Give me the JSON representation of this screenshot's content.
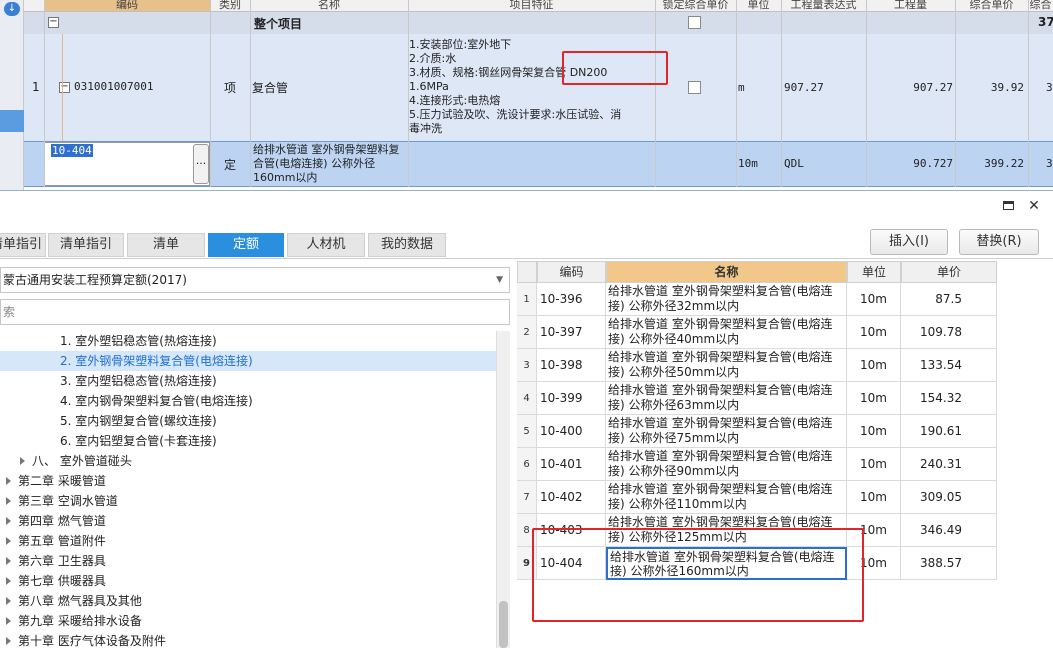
{
  "grid": {
    "headers": {
      "code": "编码",
      "type": "类别",
      "name": "名称",
      "feature": "项目特征",
      "lock": "锁定综合单价",
      "unit": "单位",
      "expr": "工程量表达式",
      "qty": "工程量",
      "price": "综合单价",
      "total": "综合"
    },
    "group_row": {
      "label": "整个项目",
      "total": "37"
    },
    "item_row": {
      "index": "1",
      "code": "031001007001",
      "type": "项",
      "name": "复合管",
      "features": [
        "1.安装部位:室外地下",
        "2.介质:水",
        "3.材质、规格:钢丝网骨架复合管 DN200",
        "1.6MPa",
        "4.连接形式:电热熔",
        "5.压力试验及吹、洗设计要求:水压试验、消",
        "毒冲洗"
      ],
      "unit": "m",
      "expr": "907.27",
      "qty": "907.27",
      "price": "39.92",
      "total": "3"
    },
    "quota_row": {
      "code": "10-404",
      "more": "···",
      "type": "定",
      "name": "给排水管道 室外钢骨架塑料复合管(电熔连接) 公称外径160mm以内",
      "unit": "10m",
      "expr": "QDL",
      "qty": "90.727",
      "price": "399.22",
      "total": "3"
    }
  },
  "dialog": {
    "tabs": [
      "清单指引",
      "清单指引",
      "清单",
      "定额",
      "人材机",
      "我的数据"
    ],
    "active_tab": 3,
    "insert_button": "插入(I)",
    "replace_button": "替换(R)",
    "library": "蒙古通用安装工程预算定额(2017)",
    "search_placeholder": "索",
    "tree": [
      {
        "label": "1. 室外塑铝稳态管(热熔连接)",
        "level": 3
      },
      {
        "label": "2. 室外钢骨架塑料复合管(电熔连接)",
        "level": 3,
        "selected": true
      },
      {
        "label": "3. 室内塑铝稳态管(热熔连接)",
        "level": 3
      },
      {
        "label": "4. 室内钢骨架塑料复合管(电熔连接)",
        "level": 3
      },
      {
        "label": "5. 室内钢塑复合管(螺纹连接)",
        "level": 3
      },
      {
        "label": "6. 室内铝塑复合管(卡套连接)",
        "level": 3
      },
      {
        "label": "八、 室外管道碰头",
        "level": 2
      },
      {
        "label": "第二章 采暖管道",
        "level": 1
      },
      {
        "label": "第三章 空调水管道",
        "level": 1
      },
      {
        "label": "第四章 燃气管道",
        "level": 1
      },
      {
        "label": "第五章 管道附件",
        "level": 1
      },
      {
        "label": "第六章 卫生器具",
        "level": 1
      },
      {
        "label": "第七章 供暖器具",
        "level": 1
      },
      {
        "label": "第八章 燃气器具及其他",
        "level": 1
      },
      {
        "label": "第九章 采暖给排水设备",
        "level": 1
      },
      {
        "label": "第十章 医疗气体设备及附件",
        "level": 1
      }
    ],
    "table": {
      "headers": {
        "code": "编码",
        "name": "名称",
        "unit": "单位",
        "price": "单价"
      },
      "rows": [
        {
          "n": "1",
          "code": "10-396",
          "name": "给排水管道 室外钢骨架塑料复合管(电熔连接) 公称外径32mm以内",
          "unit": "10m",
          "price": "87.5"
        },
        {
          "n": "2",
          "code": "10-397",
          "name": "给排水管道 室外钢骨架塑料复合管(电熔连接) 公称外径40mm以内",
          "unit": "10m",
          "price": "109.78"
        },
        {
          "n": "3",
          "code": "10-398",
          "name": "给排水管道 室外钢骨架塑料复合管(电熔连接) 公称外径50mm以内",
          "unit": "10m",
          "price": "133.54"
        },
        {
          "n": "4",
          "code": "10-399",
          "name": "给排水管道 室外钢骨架塑料复合管(电熔连接) 公称外径63mm以内",
          "unit": "10m",
          "price": "154.32"
        },
        {
          "n": "5",
          "code": "10-400",
          "name": "给排水管道 室外钢骨架塑料复合管(电熔连接) 公称外径75mm以内",
          "unit": "10m",
          "price": "190.61"
        },
        {
          "n": "6",
          "code": "10-401",
          "name": "给排水管道 室外钢骨架塑料复合管(电熔连接) 公称外径90mm以内",
          "unit": "10m",
          "price": "240.31"
        },
        {
          "n": "7",
          "code": "10-402",
          "name": "给排水管道 室外钢骨架塑料复合管(电熔连接) 公称外径110mm以内",
          "unit": "10m",
          "price": "309.05"
        },
        {
          "n": "8",
          "code": "10-403",
          "name": "给排水管道 室外钢骨架塑料复合管(电熔连接) 公称外径125mm以内",
          "unit": "10m",
          "price": "346.49"
        },
        {
          "n": "9",
          "code": "10-404",
          "name": "给排水管道 室外钢骨架塑料复合管(电熔连接) 公称外径160mm以内",
          "unit": "10m",
          "price": "388.57",
          "selected": true
        }
      ]
    }
  },
  "colors": {
    "accent": "#2b8fe0",
    "highlight": "#e0252b",
    "header_orange": "#f2c78a",
    "row_blue": "#bcd4f2"
  }
}
